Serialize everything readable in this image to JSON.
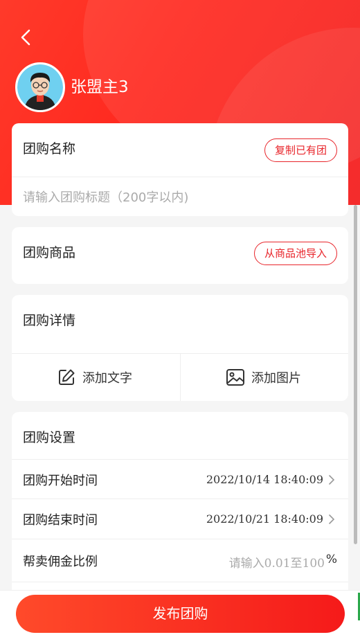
{
  "header": {
    "username": "张盟主3"
  },
  "name_card": {
    "title": "团购名称",
    "copy_button": "复制已有团",
    "input_placeholder": "请输入团购标题（200字以内)"
  },
  "goods_card": {
    "title": "团购商品",
    "import_button": "从商品池导入"
  },
  "detail_card": {
    "title": "团购详情",
    "add_text": "添加文字",
    "add_image": "添加图片"
  },
  "settings_card": {
    "title": "团购设置",
    "start_label": "团购开始时间",
    "start_value": "2022/10/14 18:40:09",
    "end_label": "团购结束时间",
    "end_value": "2022/10/21 18:40:09",
    "commission_label": "帮卖佣金比例",
    "commission_placeholder": "请输入0.01至100",
    "commission_unit": "%"
  },
  "footer": {
    "publish_button": "发布团购"
  },
  "colors": {
    "brand_red": "#f5221b",
    "text": "#222222",
    "placeholder": "#aaaaaa"
  }
}
